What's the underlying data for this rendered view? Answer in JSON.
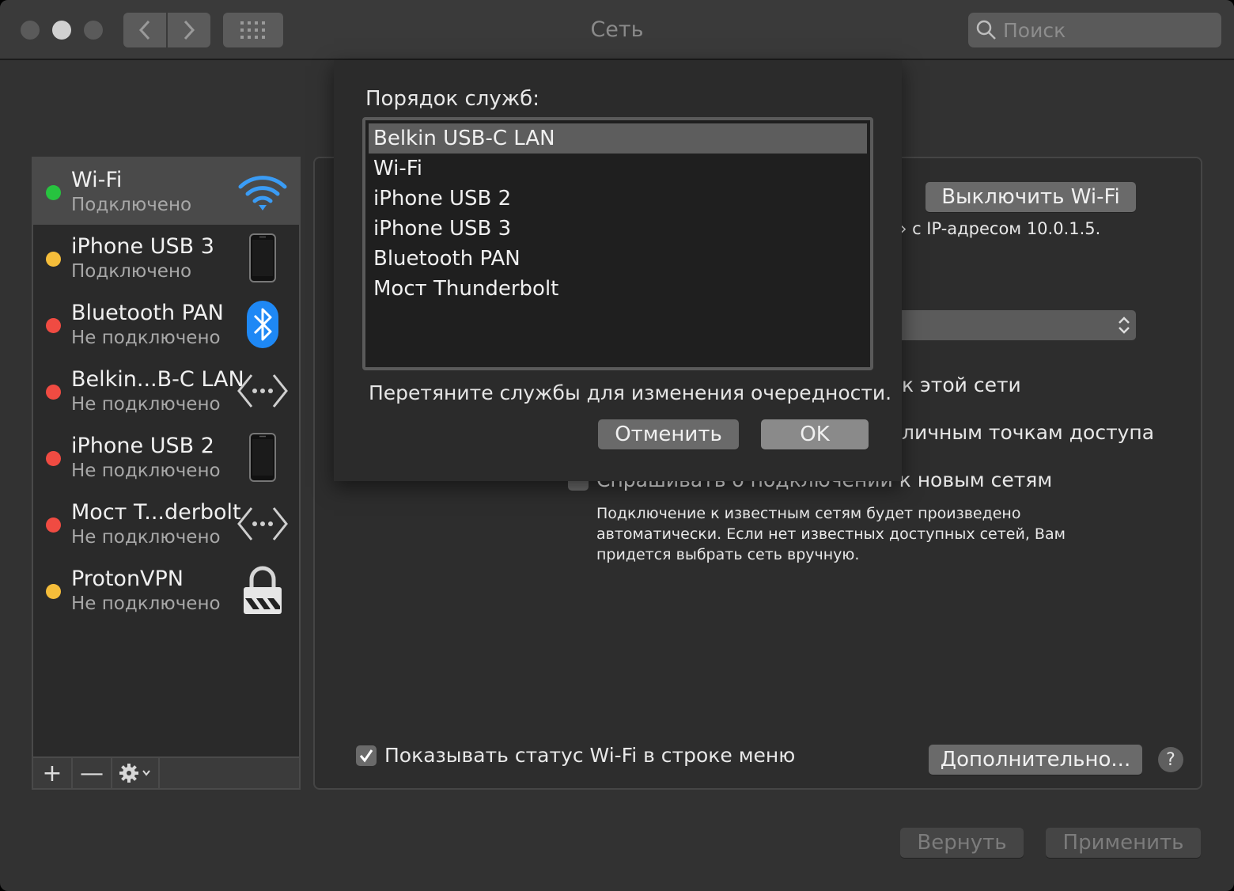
{
  "window": {
    "title": "Сеть"
  },
  "search": {
    "placeholder": "Поиск"
  },
  "sidebar": {
    "items": [
      {
        "name": "Wi-Fi",
        "status": "Подключено",
        "dot_color": "#27c33f",
        "icon": "wifi-icon"
      },
      {
        "name": "iPhone USB 3",
        "status": "Подключено",
        "dot_color": "#f5bd3a",
        "icon": "iphone-icon"
      },
      {
        "name": "Bluetooth PAN",
        "status": "Не подключено",
        "dot_color": "#f04b42",
        "icon": "bluetooth-icon"
      },
      {
        "name": "Belkin...B-C LAN",
        "status": "Не подключено",
        "dot_color": "#f04b42",
        "icon": "ethernet-arrows-icon"
      },
      {
        "name": "iPhone USB 2",
        "status": "Не подключено",
        "dot_color": "#f04b42",
        "icon": "iphone-icon"
      },
      {
        "name": "Мост T...derbolt",
        "status": "Не подключено",
        "dot_color": "#f04b42",
        "icon": "ethernet-arrows-icon"
      },
      {
        "name": "ProtonVPN",
        "status": "Не подключено",
        "dot_color": "#f5bd3a",
        "icon": "vpn-lock-icon"
      }
    ],
    "toolbar": {
      "add": "+",
      "remove": "—"
    }
  },
  "panel": {
    "wifi_off_button": "Выключить Wi-Fi",
    "ip_text": "› с IP-адресом 10.0.1.5.",
    "text_network": "к этой сети",
    "text_hotspots": "личным точкам доступа",
    "ask_new_networks": "Спрашивать о подключении к новым сетям",
    "description_lines": [
      "Подключение к известным сетям будет произведено",
      "автоматически. Если нет известных доступных сетей, Вам",
      "придется выбрать сеть вручную."
    ],
    "show_status_label": "Показывать статус Wi-Fi в строке меню",
    "advanced_button": "Дополнительно...",
    "help": "?"
  },
  "footer": {
    "revert": "Вернуть",
    "apply": "Применить"
  },
  "sheet": {
    "title": "Порядок служб:",
    "services": [
      "Belkin USB-C LAN",
      "Wi-Fi",
      "iPhone USB 2",
      "iPhone USB 3",
      "Bluetooth PAN",
      "Мост Thunderbolt"
    ],
    "selected_index": 0,
    "hint": "Перетяните службы для изменения очередности.",
    "cancel": "Отменить",
    "ok": "OK"
  },
  "colors": {
    "wifi_blue": "#3a9cf5",
    "bluetooth_blue": "#1e88f5"
  }
}
